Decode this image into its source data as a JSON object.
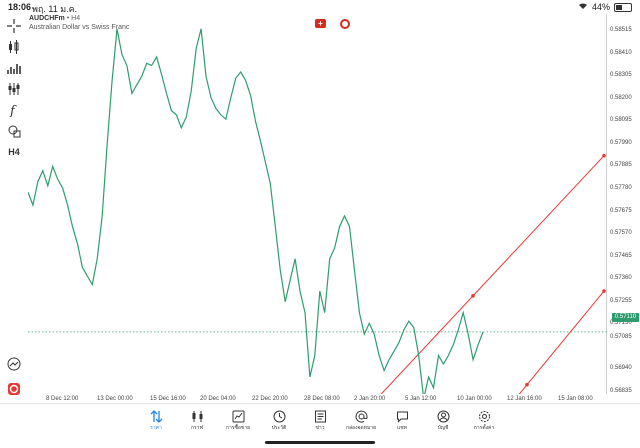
{
  "status_bar": {
    "time": "18:06",
    "date": "พฤ. 11 ม.ค.",
    "battery": "44%"
  },
  "symbol": {
    "name": "AUDCHFm",
    "separator": "•",
    "timeframe": "H4",
    "description": "Australian Dollar vs Swiss Franc"
  },
  "toolbar": {
    "timeframe_label": "H4"
  },
  "y_axis": {
    "labels": [
      "0.58515",
      "0.58410",
      "0.58305",
      "0.58200",
      "0.58095",
      "0.57990",
      "0.57885",
      "0.57780",
      "0.57675",
      "0.57570",
      "0.57465",
      "0.57360",
      "0.57255",
      "0.57150",
      "0.57085",
      "0.56940",
      "0.56835"
    ]
  },
  "current_price": "0.57110",
  "x_axis": {
    "labels": [
      "8 Dec 12:00",
      "13 Dec 00:00",
      "15 Dec 16:00",
      "20 Dec 04:00",
      "22 Dec 20:00",
      "28 Dec 08:00",
      "2 Jan 20:00",
      "5 Jan 12:00",
      "10 Jan 00:00",
      "12 Jan 16:00",
      "15 Jan 08:00"
    ]
  },
  "colors": {
    "line": "#2e9c6e",
    "trendline": "#e53935",
    "accent": "#1e88e5"
  },
  "bottom_nav": [
    {
      "label": "ราคา",
      "icon": "quotes-icon",
      "active": true
    },
    {
      "label": "กราฟ",
      "icon": "chart-icon",
      "active": false
    },
    {
      "label": "การซื้อขาย",
      "icon": "trade-icon",
      "active": false
    },
    {
      "label": "ประวัติ",
      "icon": "history-icon",
      "active": false
    },
    {
      "label": "ข่าว",
      "icon": "news-icon",
      "active": false
    },
    {
      "label": "กล่องจดหมาย",
      "icon": "mailbox-icon",
      "active": false
    },
    {
      "label": "แชท",
      "icon": "chat-icon",
      "active": false
    },
    {
      "label": "บัญชี",
      "icon": "account-icon",
      "active": false
    },
    {
      "label": "การตั้งค่า",
      "icon": "settings-icon",
      "active": false
    }
  ],
  "chart_data": {
    "type": "line",
    "title": "",
    "x": [
      "8 Dec 12:00",
      "13 Dec 00:00",
      "15 Dec 16:00",
      "20 Dec 04:00",
      "22 Dec 20:00",
      "28 Dec 08:00",
      "2 Jan 20:00",
      "5 Jan 12:00",
      "10 Jan 00:00"
    ],
    "series": [
      {
        "values": [
          0.5776,
          0.577,
          0.5781,
          0.5786,
          0.5779,
          0.5788,
          0.5782,
          0.5778,
          0.577,
          0.576,
          0.5752,
          0.5741,
          0.5737,
          0.5733,
          0.5745,
          0.5765,
          0.5798,
          0.5828,
          0.5852,
          0.584,
          0.5835,
          0.5822,
          0.5826,
          0.583,
          0.5836,
          0.5835,
          0.5839,
          0.5831,
          0.5822,
          0.5814,
          0.5812,
          0.5806,
          0.5811,
          0.5823,
          0.5843,
          0.5852,
          0.583,
          0.582,
          0.5815,
          0.5812,
          0.581,
          0.582,
          0.5829,
          0.5832,
          0.5828,
          0.5821,
          0.5809,
          0.58,
          0.579,
          0.578,
          0.576,
          0.574,
          0.5725,
          0.5735,
          0.5745,
          0.573,
          0.572,
          0.569,
          0.57,
          0.573,
          0.572,
          0.5745,
          0.575,
          0.576,
          0.5765,
          0.576,
          0.574,
          0.572,
          0.571,
          0.5715,
          0.571,
          0.57,
          0.5693,
          0.5698,
          0.5702,
          0.5706,
          0.5712,
          0.5716,
          0.5713,
          0.57,
          0.568,
          0.569,
          0.5685,
          0.57,
          0.5696,
          0.57,
          0.5705,
          0.5712,
          0.572,
          0.571,
          0.5698,
          0.5705,
          0.5711
        ],
        "color": "#2e9c6e"
      }
    ],
    "ylim": [
      0.56785,
      0.5858
    ],
    "current_price": 0.5711,
    "trendlines": [
      {
        "from_x": "2 Jan 20:00",
        "to_x": "15 Jan 08:00",
        "from_y": 0.5678,
        "to_y": 0.5793,
        "color": "#e53935"
      },
      {
        "from_x": "5 Jan 12:00",
        "to_x": "15 Jan 08:00",
        "from_y": 0.567,
        "to_y": 0.573,
        "color": "#e53935"
      }
    ],
    "grid": false
  }
}
